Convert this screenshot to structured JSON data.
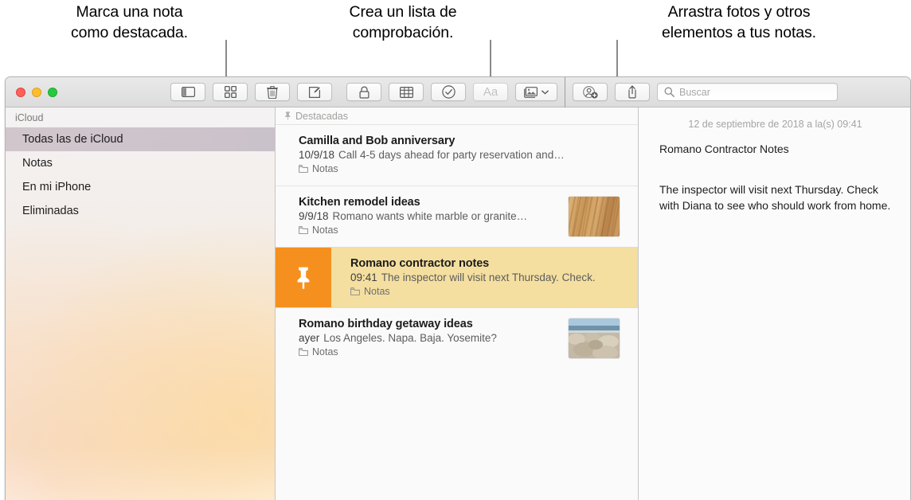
{
  "callouts": [
    {
      "id": "pin-callout",
      "lines": [
        "Marca una nota",
        "como destacada."
      ]
    },
    {
      "id": "check-callout",
      "lines": [
        "Crea un lista de",
        "comprobación."
      ]
    },
    {
      "id": "drag-callout",
      "lines": [
        "Arrastra fotos y otros",
        "elementos a tus notas."
      ]
    }
  ],
  "window": {
    "traffic_lights": [
      {
        "name": "close",
        "color": "#ff6159"
      },
      {
        "name": "minimize",
        "color": "#ffbd2e"
      },
      {
        "name": "zoom",
        "color": "#28c940"
      }
    ],
    "toolbar": {
      "buttons": [
        {
          "name": "sidebar-toggle",
          "icon": "sidebar-icon",
          "label": "",
          "enabled": true
        },
        {
          "name": "gallery-view",
          "icon": "grid-icon",
          "label": "",
          "enabled": true
        },
        {
          "name": "delete-note",
          "icon": "trash-icon",
          "label": "",
          "enabled": true
        },
        {
          "name": "compose-note",
          "icon": "compose-icon",
          "label": "",
          "enabled": true
        },
        {
          "name": "lock-note",
          "icon": "lock-icon",
          "label": "",
          "enabled": true
        },
        {
          "name": "insert-table",
          "icon": "table-icon",
          "label": "",
          "enabled": true
        },
        {
          "name": "checklist",
          "icon": "check-circle-icon",
          "label": "",
          "enabled": true
        },
        {
          "name": "text-format",
          "icon": "aa-icon",
          "label": "Aa",
          "enabled": false
        },
        {
          "name": "insert-media",
          "icon": "media-icon",
          "label": "",
          "enabled": true
        },
        {
          "name": "add-people",
          "icon": "add-person-icon",
          "label": "",
          "enabled": true
        },
        {
          "name": "share-note",
          "icon": "share-icon",
          "label": "",
          "enabled": true
        }
      ],
      "search": {
        "placeholder": "Buscar",
        "value": "",
        "icon": "search-icon"
      }
    }
  },
  "sidebar": {
    "header": "iCloud",
    "items": [
      {
        "label": "Todas las de iCloud",
        "selected": true
      },
      {
        "label": "Notas",
        "selected": false
      },
      {
        "label": "En mi iPhone",
        "selected": false
      },
      {
        "label": "Eliminadas",
        "selected": false
      }
    ]
  },
  "notes_list": {
    "section_header": "Destacadas",
    "section_icon": "pin-icon",
    "notes": [
      {
        "title": "Camilla and Bob anniversary",
        "date": "10/9/18",
        "preview": "Call 4-5 days ahead for party reservation and…",
        "folder": "Notas",
        "pinned": false,
        "selected": false,
        "thumbnail": "none"
      },
      {
        "title": "Kitchen remodel ideas",
        "date": "9/9/18",
        "preview": "Romano wants white marble or granite…",
        "folder": "Notas",
        "pinned": false,
        "selected": false,
        "thumbnail": "wood-floor-photo"
      },
      {
        "title": "Romano contractor notes",
        "date": "09:41",
        "preview": "The inspector will visit next Thursday. Check.",
        "folder": "Notas",
        "pinned": true,
        "selected": true,
        "thumbnail": "none"
      },
      {
        "title": "Romano birthday getaway ideas",
        "date": "ayer",
        "preview": "Los Angeles. Napa. Baja. Yosemite?",
        "folder": "Notas",
        "pinned": false,
        "selected": false,
        "thumbnail": "beach-rocks-photo"
      }
    ]
  },
  "detail": {
    "date": "12 de septiembre de 2018 a la(s) 09:41",
    "title": "Romano Contractor Notes",
    "body": "The inspector will visit next Thursday. Check with Diana to see who should work from home."
  },
  "colors": {
    "pin_orange": "#f5901f",
    "pinned_row": "#f4dfa0",
    "selected_sidebar": "#c4b6be",
    "callout_line": "#8a8a8a"
  }
}
